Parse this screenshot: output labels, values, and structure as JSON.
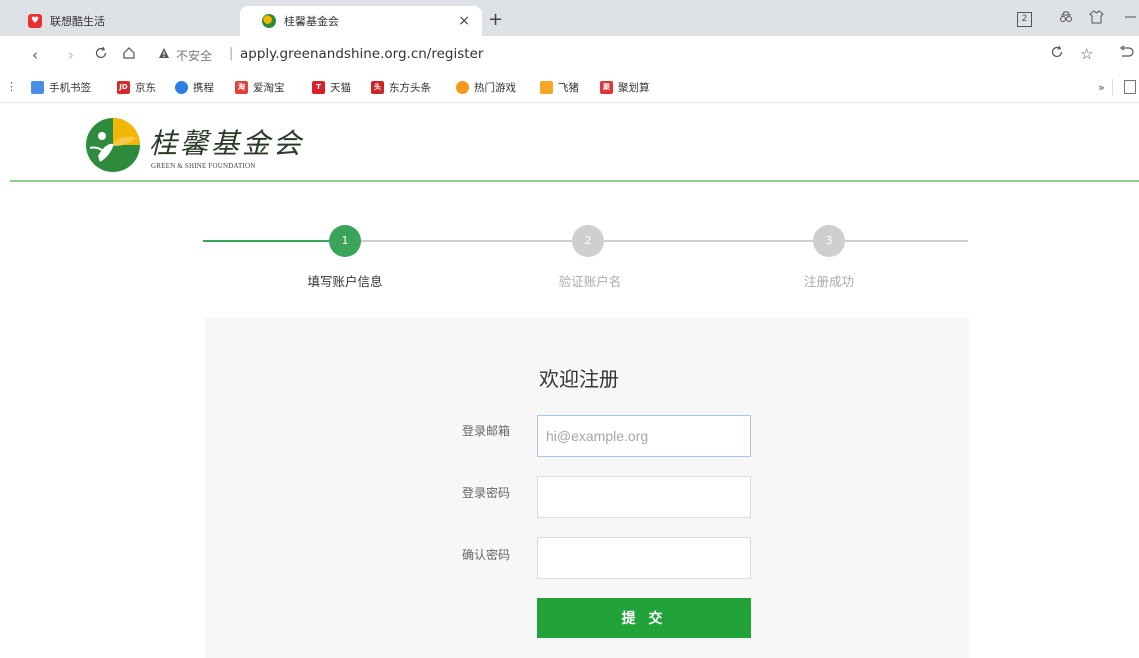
{
  "browser": {
    "tabs": [
      {
        "title": "联想酷生活",
        "active": false
      },
      {
        "title": "桂馨基金会",
        "active": true
      }
    ],
    "tab_close": "×",
    "new_tab": "+",
    "address": {
      "security_text": "不安全",
      "separator": "|",
      "url": "apply.greenandshine.org.cn/register"
    },
    "icons": [
      "back-icon",
      "forward-icon",
      "reload-icon",
      "home-icon",
      "warning-icon",
      "refresh-icon",
      "star-icon",
      "undo-icon"
    ],
    "bookmarks": [
      {
        "label": "手机书签",
        "color": "#4a8ee6",
        "glyph": ""
      },
      {
        "label": "京东",
        "color": "#d52a2a",
        "glyph": "JD"
      },
      {
        "label": "携程",
        "color": "#2a7de1",
        "glyph": ""
      },
      {
        "label": "爱淘宝",
        "color": "#e0433a",
        "glyph": "淘"
      },
      {
        "label": "天猫",
        "color": "#d6202c",
        "glyph": "T"
      },
      {
        "label": "东方头条",
        "color": "#c9282a",
        "glyph": "头"
      },
      {
        "label": "热门游戏",
        "color": "#f29a1d",
        "glyph": ""
      },
      {
        "label": "飞猪",
        "color": "#f5a623",
        "glyph": ""
      },
      {
        "label": "聚划算",
        "color": "#e2343b",
        "glyph": "聚"
      }
    ],
    "more": "»",
    "window": {
      "tab_count": "2"
    }
  },
  "site": {
    "logo_title": "桂馨基金会",
    "logo_sub": "GREEN & SHINE FOUNDATION",
    "brand_color": "#22a33a"
  },
  "steps": [
    {
      "number": "1",
      "label": "填写账户信息",
      "active": true
    },
    {
      "number": "2",
      "label": "验证账户名",
      "active": false
    },
    {
      "number": "3",
      "label": "注册成功",
      "active": false
    }
  ],
  "form": {
    "title": "欢迎注册",
    "email_label": "登录邮箱",
    "email_placeholder": "hi@example.org",
    "email_value": "",
    "password_label": "登录密码",
    "password_value": "",
    "confirm_label": "确认密码",
    "confirm_value": "",
    "submit_label": "提 交"
  }
}
